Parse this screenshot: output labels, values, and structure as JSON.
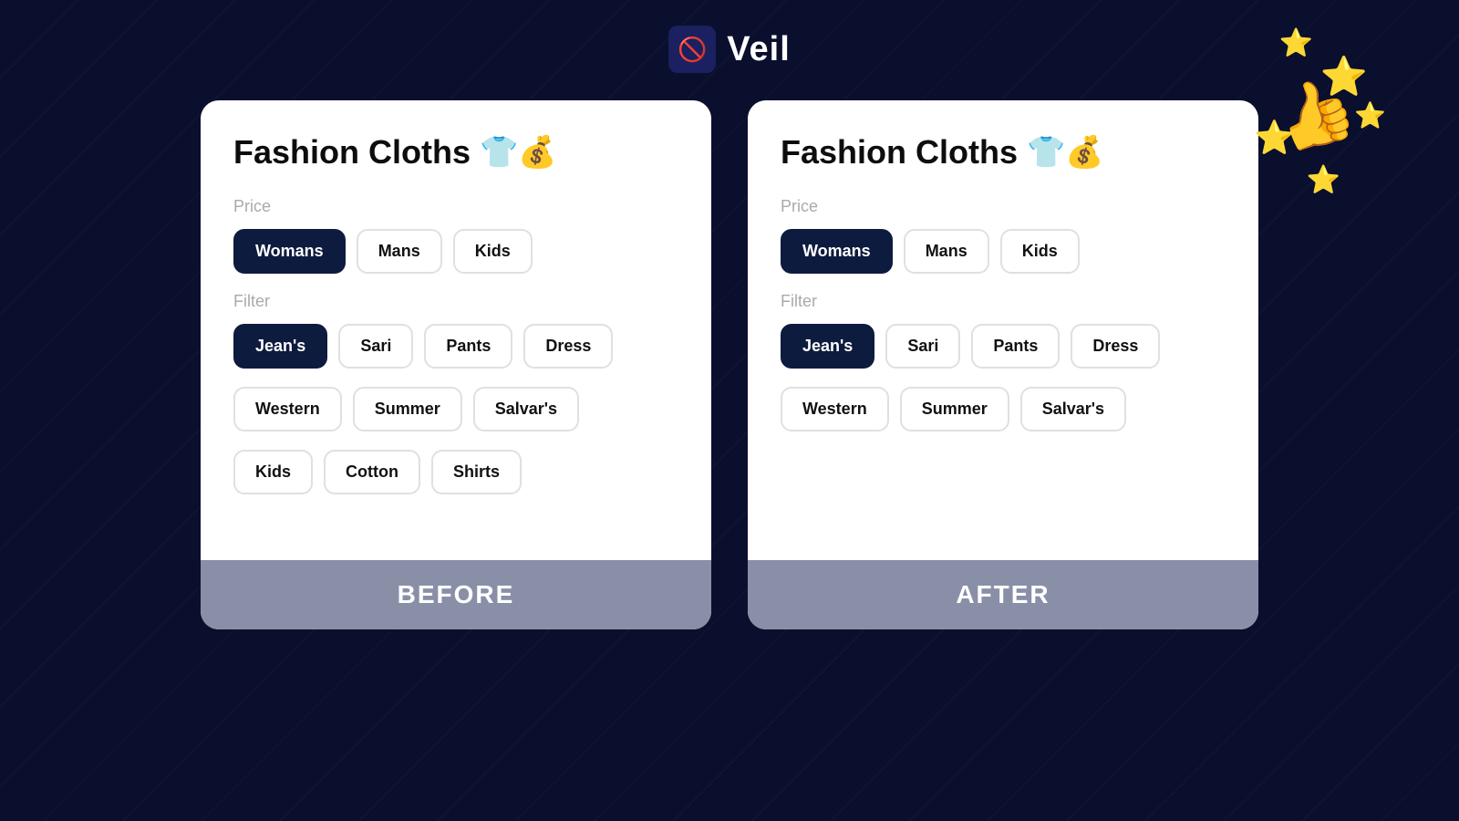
{
  "header": {
    "logo_icon": "🚫👁",
    "logo_text": "Veil"
  },
  "before": {
    "title": "Fashion Cloths",
    "title_emoji": "👕💰",
    "price_label": "Price",
    "price_tags": [
      {
        "label": "Womans",
        "active": true
      },
      {
        "label": "Mans",
        "active": false
      },
      {
        "label": "Kids",
        "active": false
      }
    ],
    "filter_label": "Filter",
    "filter_tags_row1": [
      {
        "label": "Jean's",
        "active": true
      },
      {
        "label": "Sari",
        "active": false
      },
      {
        "label": "Pants",
        "active": false
      },
      {
        "label": "Dress",
        "active": false
      }
    ],
    "filter_tags_row2": [
      {
        "label": "Western",
        "active": false
      },
      {
        "label": "Summer",
        "active": false
      },
      {
        "label": "Salvar's",
        "active": false
      }
    ],
    "filter_tags_row3": [
      {
        "label": "Kids",
        "active": false
      },
      {
        "label": "Cotton",
        "active": false
      },
      {
        "label": "Shirts",
        "active": false
      }
    ],
    "footer_label": "BEFORE"
  },
  "after": {
    "title": "Fashion Cloths",
    "title_emoji": "👕💰",
    "price_label": "Price",
    "price_tags": [
      {
        "label": "Womans",
        "active": true
      },
      {
        "label": "Mans",
        "active": false
      },
      {
        "label": "Kids",
        "active": false
      }
    ],
    "filter_label": "Filter",
    "filter_tags_row1": [
      {
        "label": "Jean's",
        "active": true
      },
      {
        "label": "Sari",
        "active": false
      },
      {
        "label": "Pants",
        "active": false
      },
      {
        "label": "Dress",
        "active": false
      }
    ],
    "filter_tags_row2": [
      {
        "label": "Western",
        "active": false
      },
      {
        "label": "Summer",
        "active": false
      },
      {
        "label": "Salvar's",
        "active": false
      }
    ],
    "footer_label": "AFTER"
  },
  "decoration": {
    "stars": [
      "⭐",
      "⭐",
      "⭐",
      "⭐",
      "⭐"
    ],
    "hand": "👍"
  }
}
